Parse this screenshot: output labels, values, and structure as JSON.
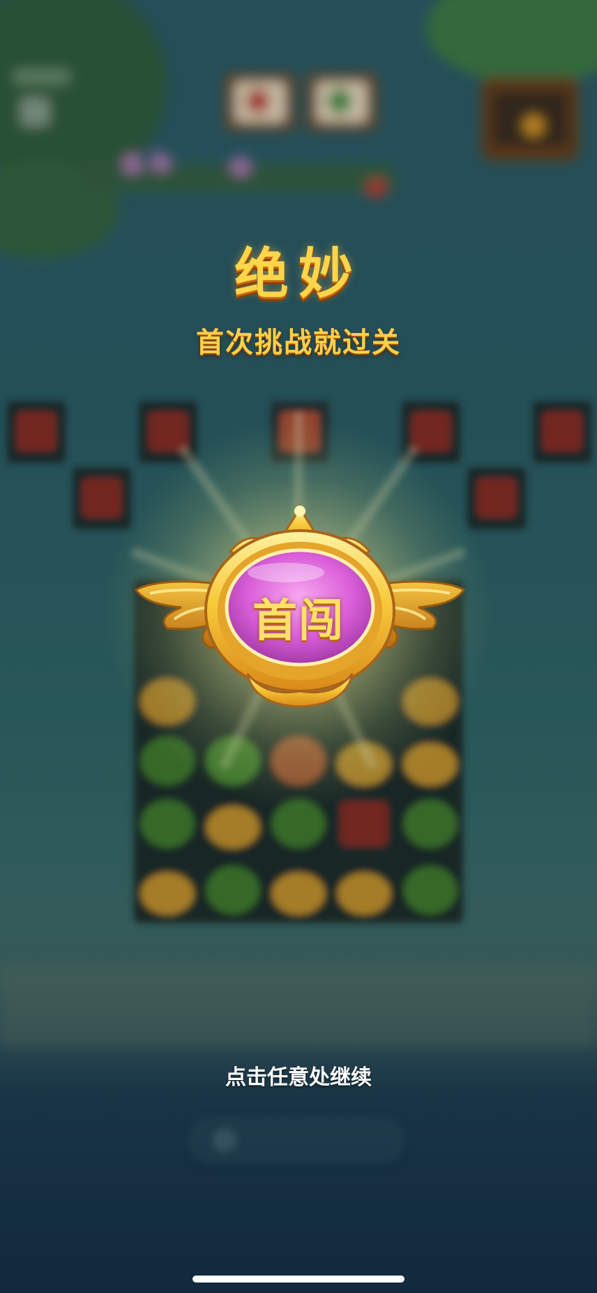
{
  "result": {
    "title": "绝妙",
    "subtitle": "首次挑战就过关",
    "badge_text": "首闯",
    "continue_hint": "点击任意处继续"
  }
}
